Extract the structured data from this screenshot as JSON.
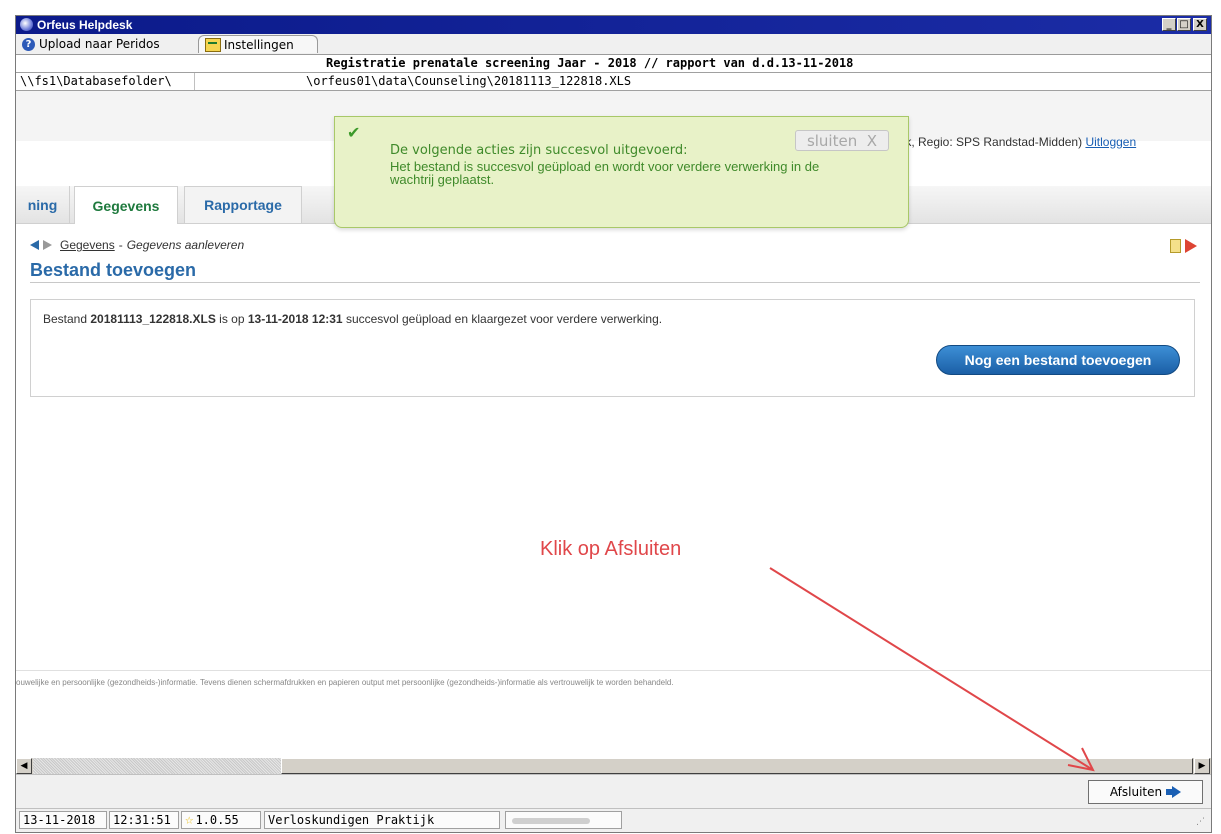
{
  "window": {
    "title": "Orfeus Helpdesk",
    "controls": [
      "_",
      "□",
      "X"
    ]
  },
  "tabs": [
    {
      "label": "Upload naar Peridos",
      "icon": "help-icon"
    },
    {
      "label": "Instellingen",
      "icon": "settings-icon"
    }
  ],
  "report": {
    "header": "Registratie prenatale screening Jaar - 2018 // rapport van d.d.13-11-2018",
    "path_left": "\\\\fs1\\Databasefolder\\",
    "path_right": "\\orfeus01\\data\\Counseling\\20181113_122818.XLS"
  },
  "user_line": {
    "info": "raktijk, Regio: SPS Randstad-Midden)",
    "logout": "Uitloggen"
  },
  "popup": {
    "heading": "De volgende acties zijn succesvol uitgevoerd:",
    "message": "Het bestand is succesvol geüpload en wordt voor verdere verwerking in de wachtrij geplaatst.",
    "close_label": "sluiten",
    "close_x": "X"
  },
  "nav": {
    "tabs": [
      "ning",
      "Gegevens",
      "Rapportage"
    ],
    "active": "Gegevens"
  },
  "breadcrumb": {
    "link": "Gegevens",
    "separator": "-",
    "current": "Gegevens aanleveren"
  },
  "section": {
    "title": "Bestand toevoegen"
  },
  "result": {
    "pre": "Bestand ",
    "filename": "20181113_122818.XLS",
    "mid": " is op ",
    "datetime": "13-11-2018 12:31",
    "post": " succesvol geüpload en klaargezet voor verdere verwerking.",
    "button": "Nog een bestand toevoegen"
  },
  "footnote": "ouwelijke en persoonlijke (gezondheids-)informatie. Tevens dienen schermafdrukken en papieren output met persoonlijke (gezondheids-)informatie als vertrouwelijk te worden behandeld.",
  "bottom": {
    "close_button": "Afsluiten"
  },
  "status": {
    "date": "13-11-2018",
    "time": "12:31:51",
    "version": "1.0.55",
    "practice": "Verloskundigen Praktijk"
  },
  "annotation": {
    "text": "Klik op Afsluiten",
    "color": "#e0474a"
  },
  "colors": {
    "titlebar": "#0b1a8a",
    "link_blue": "#2a6aa8",
    "success_green": "#3f8a2a",
    "popup_bg": "#e8f2c8"
  }
}
